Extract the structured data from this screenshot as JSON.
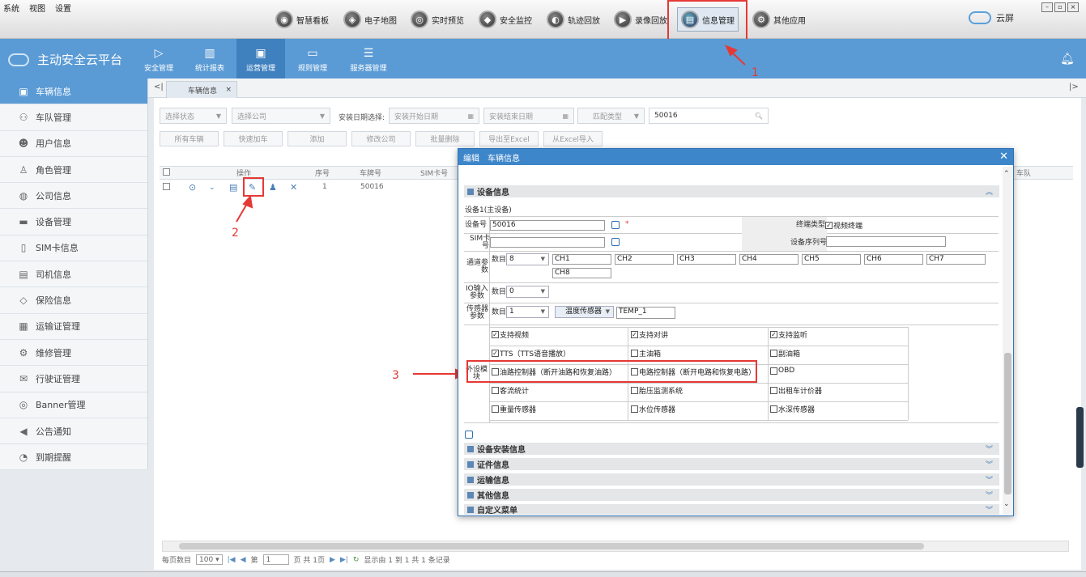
{
  "menu": [
    "系统",
    "视图",
    "设置"
  ],
  "top_buttons": [
    {
      "label": "智慧看板",
      "icon": "dashboard-icon"
    },
    {
      "label": "电子地图",
      "icon": "map-icon"
    },
    {
      "label": "实时预览",
      "icon": "video-icon"
    },
    {
      "label": "安全监控",
      "icon": "shield-icon"
    },
    {
      "label": "轨迹回放",
      "icon": "track-icon"
    },
    {
      "label": "录像回放",
      "icon": "playback-icon"
    },
    {
      "label": "信息管理",
      "icon": "info-icon"
    },
    {
      "label": "其他应用",
      "icon": "apps-icon"
    }
  ],
  "cloud_label": "云屏",
  "brand": "主动安全云平台",
  "nav_tabs": [
    "安全管理",
    "统计报表",
    "运营管理",
    "规则管理",
    "服务器管理"
  ],
  "sidebar": [
    "车辆信息",
    "车队管理",
    "用户信息",
    "角色管理",
    "公司信息",
    "设备管理",
    "SIM卡信息",
    "司机信息",
    "保险信息",
    "运输证管理",
    "维修管理",
    "行驶证管理",
    "Banner管理",
    "公告通知",
    "到期提醒"
  ],
  "tab_label": "车辆信息",
  "filters": {
    "status": "选择状态",
    "company": "选择公司",
    "date_label": "安装日期选择:",
    "start": "安装开始日期",
    "end": "安装结束日期",
    "match": "匹配类型",
    "search_value": "50016"
  },
  "actions": [
    "所有车辆",
    "快速加车",
    "添加",
    "修改公司",
    "批量删除",
    "导出至Excel",
    "从Excel导入"
  ],
  "grid": {
    "headers": [
      "操作",
      "序号",
      "车牌号",
      "SIM卡号"
    ],
    "row": {
      "index": "1",
      "plate": "50016"
    },
    "extra_header": "车队"
  },
  "pager": {
    "per_page_label": "每页数目",
    "per_page": "100",
    "page_prefix": "第",
    "page_value": "1",
    "page_suffix": "页 共 1页",
    "summary": "显示由 1 到 1 共 1 条记录"
  },
  "annotations": [
    "1",
    "2",
    "3"
  ],
  "dialog": {
    "title_edit": "编辑",
    "title": "车辆信息",
    "section_device": "设备信息",
    "device_subtitle": "设备1(主设备)",
    "device_no_label": "设备号",
    "device_no": "50016",
    "required": "*",
    "terminal_type_label": "终端类型",
    "terminal_type": "视频终端",
    "sim_label_1": "SIM卡",
    "sim_label_2": "号",
    "serial_label": "设备序列号",
    "channel_label_1": "通道参",
    "channel_label_2": "数",
    "count_label": "数目",
    "channel_count": "8",
    "channels": [
      "CH1",
      "CH2",
      "CH3",
      "CH4",
      "CH5",
      "CH6",
      "CH7",
      "CH8"
    ],
    "io_label_1": "IO输入",
    "io_label_2": "参数",
    "io_count": "0",
    "sensor_label_1": "传感器",
    "sensor_label_2": "参数",
    "sensor_count": "1",
    "sensor_type": "温度传感器",
    "sensor_name": "TEMP_1",
    "peripheral_label_1": "外设模",
    "peripheral_label_2": "块",
    "peripherals": [
      {
        "label": "支持视频",
        "checked": true
      },
      {
        "label": "支持对讲",
        "checked": true
      },
      {
        "label": "支持监听",
        "checked": true
      },
      {
        "label": "TTS（TTS语音播放）",
        "checked": true
      },
      {
        "label": "主油箱",
        "checked": false
      },
      {
        "label": "副油箱",
        "checked": false
      },
      {
        "label": "油路控制器（断开油路和恢复油路）",
        "checked": false
      },
      {
        "label": "电路控制器（断开电路和恢复电路）",
        "checked": false
      },
      {
        "label": "OBD",
        "checked": false
      },
      {
        "label": "客流统计",
        "checked": false
      },
      {
        "label": "胎压监测系统",
        "checked": false
      },
      {
        "label": "出租车计价器",
        "checked": false
      },
      {
        "label": "重量传感器",
        "checked": false
      },
      {
        "label": "水位传感器",
        "checked": false
      },
      {
        "label": "水深传感器",
        "checked": false
      }
    ],
    "sections": [
      "设备安装信息",
      "证件信息",
      "运输信息",
      "其他信息",
      "自定义菜单"
    ]
  },
  "colors": {
    "header": "#5b9bd5",
    "highlight": "#e53935",
    "dialog_title": "#3d86c9"
  }
}
